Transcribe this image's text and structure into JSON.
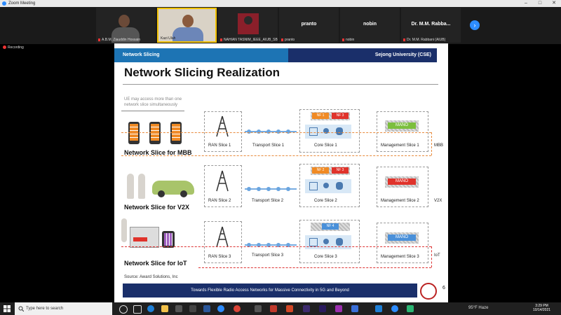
{
  "window": {
    "title": "Zoom Meeting"
  },
  "participants": [
    {
      "name": "A.B.M. Ziauddin Hossain"
    },
    {
      "name": "Kazi Ulah"
    },
    {
      "name": "NAHIAN TASNIM_IEEE_AIUB_SB"
    },
    {
      "name": "pranto",
      "display": "pranto"
    },
    {
      "name": "nobin",
      "display": "nobin"
    },
    {
      "name": "Dr. M.M. Rabbani (AIUB)",
      "display": "Dr. M.M. Rabba..."
    }
  ],
  "recording_label": "Recording",
  "slide": {
    "header_left": "Network Slicing",
    "header_right": "Sejong University (CSE)",
    "title": "Network Slicing Realization",
    "ue_note": "UE may access more than one network slice simultaneously",
    "rows": [
      {
        "slice_name": "Network Slice for MBB",
        "ran": "RAN Slice 1",
        "transport": "Transport Slice 1",
        "core": "Core Slice 1",
        "mgmt": "Management Slice 1",
        "tag": "MBB",
        "nfs": [
          "NF 1",
          "NF 3"
        ],
        "mano": "MANO"
      },
      {
        "slice_name": "Network Slice for V2X",
        "ran": "RAN Slice 2",
        "transport": "Transport Slice 2",
        "core": "Core Slice 2",
        "mgmt": "Management Slice 2",
        "tag": "V2X",
        "nfs": [
          "NF 2",
          "NF 3"
        ],
        "mano": "MANO"
      },
      {
        "slice_name": "Network Slice for IoT",
        "ran": "RAN Slice 3",
        "transport": "Transport Slice 3",
        "core": "Core Slice 3",
        "mgmt": "Management Slice 3",
        "tag": "IoT",
        "nfs": [
          "NF 4"
        ],
        "mano": "MANO"
      }
    ],
    "source": "Source: Award Solutions, Inc",
    "footer": "Towards Flexible Radio Access Networks for Massive Connectivity in 5G and Beyond",
    "page_number": "6"
  },
  "taskbar": {
    "search_placeholder": "Type here to search",
    "weather": "95°F  Haze",
    "time": "3:29 PM",
    "date": "10/14/2021"
  },
  "colors": {
    "header_blue": "#1d74b4",
    "header_navy": "#1a2f6a",
    "mbb_line": "#e88a3c",
    "iot_line": "#d33333",
    "nf_orange": "#f08a24",
    "nf_red": "#e0332b",
    "nf_blue": "#4a90d9",
    "mano_green": "#7cbf3d",
    "mano_red": "#e0332b",
    "mano_blue": "#4a90d9"
  }
}
